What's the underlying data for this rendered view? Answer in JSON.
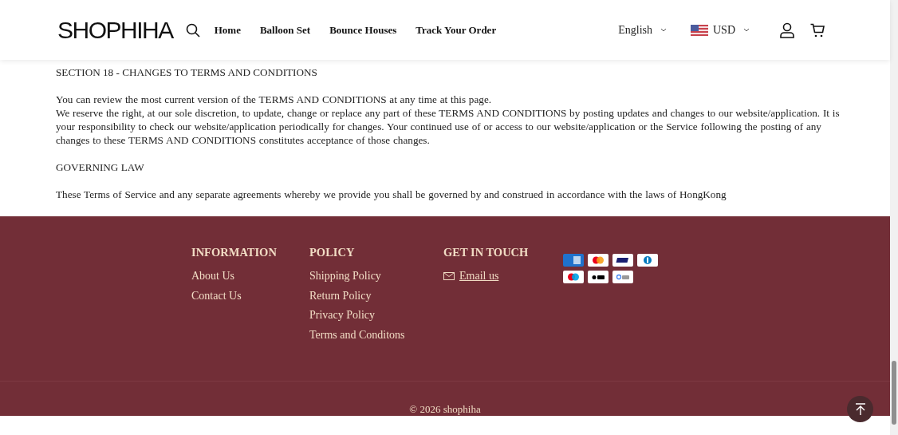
{
  "header": {
    "logo": "SHOPHIHA",
    "nav": [
      "Home",
      "Balloon Set",
      "Bounce Houses",
      "Track Your Order"
    ],
    "language": "English",
    "currency": "USD"
  },
  "content": [
    {
      "kind": "heading",
      "text": "SECTION 18 - CHANGES TO TERMS AND CONDITIONS"
    },
    {
      "kind": "paragraph",
      "lines": [
        "You can review the most current version of the TERMS AND CONDITIONS at any time at this page.",
        "We reserve the right, at our sole discretion, to update, change or replace any part of these TERMS AND CONDITIONS by posting updates and changes to our website/application. It is your responsibility to check our website/application periodically for changes. Your continued use of or access to our website/application or the Service following the posting of any changes to these TERMS AND CONDITIONS constitutes acceptance of those changes."
      ]
    },
    {
      "kind": "heading",
      "text": "GOVERNING LAW"
    },
    {
      "kind": "paragraph",
      "lines": [
        "These Terms of Service and any separate agreements whereby we provide you shall be governed by and construed in accordance with the laws of  HongKong"
      ]
    }
  ],
  "footer": {
    "columns": [
      {
        "title": "INFORMATION",
        "links": [
          "About Us",
          "Contact Us"
        ]
      },
      {
        "title": "POLICY",
        "links": [
          "Shipping Policy",
          "Return Policy",
          "Privacy Policy",
          "Terms and Conditons"
        ]
      },
      {
        "title": "GET IN TOUCH",
        "email": "Email us"
      }
    ],
    "copyright": "© 2026 shophiha"
  }
}
